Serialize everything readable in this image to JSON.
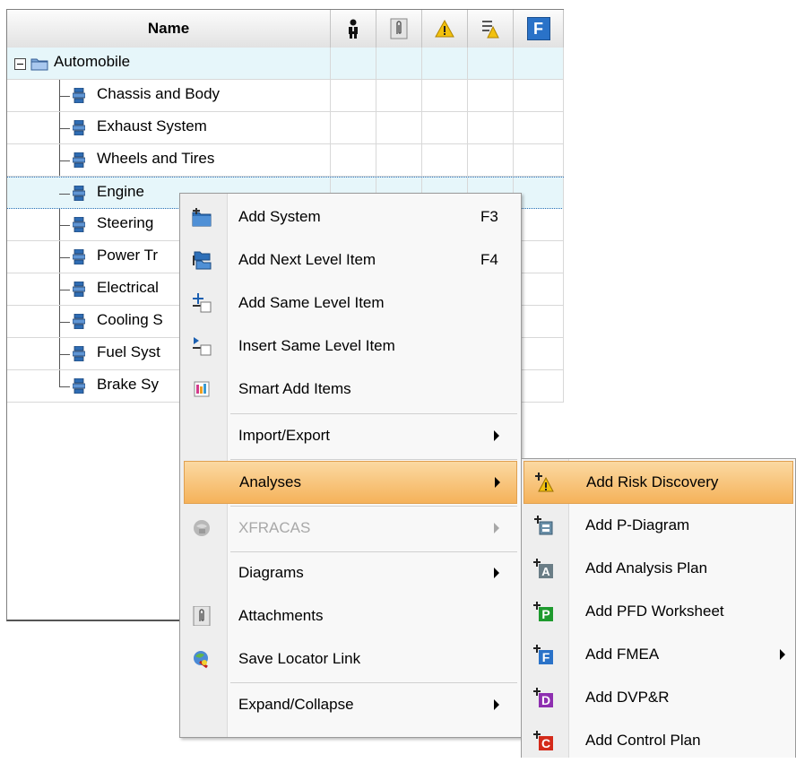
{
  "grid": {
    "header": {
      "name": "Name",
      "column_icons": [
        "person-icon",
        "paperclip-icon",
        "warning-icon",
        "list-warning-icon",
        "fmea-f-icon"
      ]
    },
    "root": "Automobile",
    "children": [
      "Chassis and Body",
      "Exhaust System",
      "Wheels and Tires",
      "Engine",
      "Steering",
      "Power Tr",
      "Electrical",
      "Cooling S",
      "Fuel Syst",
      "Brake Sy"
    ]
  },
  "context_menu": {
    "items": [
      {
        "label": "Add System",
        "shortcut": "F3",
        "icon": "add-system-icon"
      },
      {
        "label": "Add Next Level Item",
        "shortcut": "F4",
        "icon": "add-next-level-icon"
      },
      {
        "label": "Add Same Level Item",
        "icon": "add-same-level-icon"
      },
      {
        "label": "Insert Same Level Item",
        "icon": "insert-same-level-icon"
      },
      {
        "label": "Smart Add Items",
        "icon": "smart-add-icon"
      },
      {
        "label": "Import/Export",
        "submenu": true
      },
      {
        "label": "Analyses",
        "submenu": true,
        "active": true
      },
      {
        "label": "XFRACAS",
        "submenu": true,
        "disabled": true,
        "icon": "xfracas-icon"
      },
      {
        "label": "Diagrams",
        "submenu": true
      },
      {
        "label": "Attachments",
        "icon": "paperclip-icon"
      },
      {
        "label": "Save Locator Link",
        "icon": "locator-link-icon"
      },
      {
        "label": "Expand/Collapse",
        "submenu": true
      }
    ]
  },
  "analyses_submenu": {
    "items": [
      {
        "label": "Add Risk Discovery",
        "icon": "risk-discovery-icon",
        "active": true
      },
      {
        "label": "Add P-Diagram",
        "icon": "p-diagram-icon"
      },
      {
        "label": "Add Analysis Plan",
        "icon": "analysis-plan-icon",
        "letter": "A"
      },
      {
        "label": "Add PFD Worksheet",
        "icon": "pfd-worksheet-icon",
        "letter": "P"
      },
      {
        "label": "Add FMEA",
        "icon": "fmea-icon",
        "letter": "F",
        "submenu": true
      },
      {
        "label": "Add DVP&R",
        "icon": "dvpr-icon",
        "letter": "D"
      },
      {
        "label": "Add Control Plan",
        "icon": "control-plan-icon",
        "letter": "C"
      }
    ]
  },
  "colors": {
    "highlight_row": "#e6f6fa",
    "menu_active": "#f5b25a",
    "pfd_green": "#1e9a2e",
    "fmea_blue": "#2a72c8",
    "dvpr_purple": "#8e2fb0",
    "control_red": "#d42a1a",
    "analysis_gray": "#6a7d86"
  }
}
